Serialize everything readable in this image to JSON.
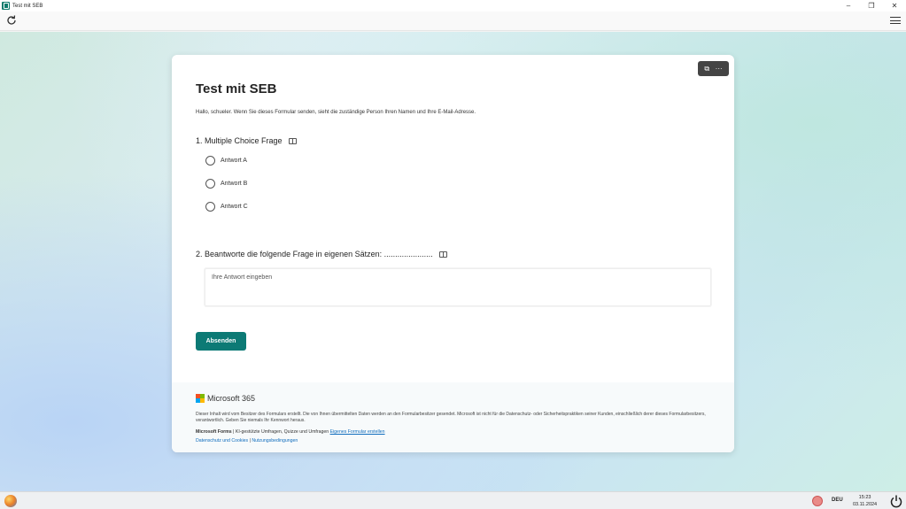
{
  "window": {
    "title": "Test mit SEB",
    "minimize": "–",
    "restore": "❐",
    "close": "✕"
  },
  "toolbar": {
    "reload_icon": "reload-icon",
    "menu_icon": "hamburger-menu-icon"
  },
  "form": {
    "title": "Test mit SEB",
    "description": "Hallo, schueler. Wenn Sie dieses Formular senden, sieht die zuständige Person Ihren Namen und Ihre E-Mail-Adresse.",
    "questions": [
      {
        "label": "1. Multiple Choice Frage",
        "options": [
          "Antwort A",
          "Antwort B",
          "Antwort C"
        ]
      },
      {
        "label": "2. Beantworte die folgende Frage in eigenen Sätzen: ......................",
        "placeholder": "Ihre Antwort eingeben"
      }
    ],
    "submit_label": "Absenden"
  },
  "footer": {
    "brand": "Microsoft 365",
    "disclaimer": "Dieser Inhalt wird vom Besitzer des Formulars erstellt. Die von Ihnen übermittelten Daten werden an den Formularbesitzer gesendet. Microsoft ist nicht für die Datenschutz- oder Sicherheitspraktiken seiner Kunden, einschließlich derer dieses Formularbesitzers, verantwortlich. Geben Sie niemals Ihr Kennwort heraus.",
    "forms_label": "Microsoft Forms",
    "forms_text": " | KI-gestützte Umfragen, Quizze und Umfragen ",
    "create_link": "Eigenes Formular erstellen",
    "privacy_link": "Datenschutz und Cookies",
    "separator": " | ",
    "terms_link": "Nutzungsbedingungen"
  },
  "taskbar": {
    "language": "DEU",
    "time": "15:23",
    "date": "03.11.2024"
  }
}
